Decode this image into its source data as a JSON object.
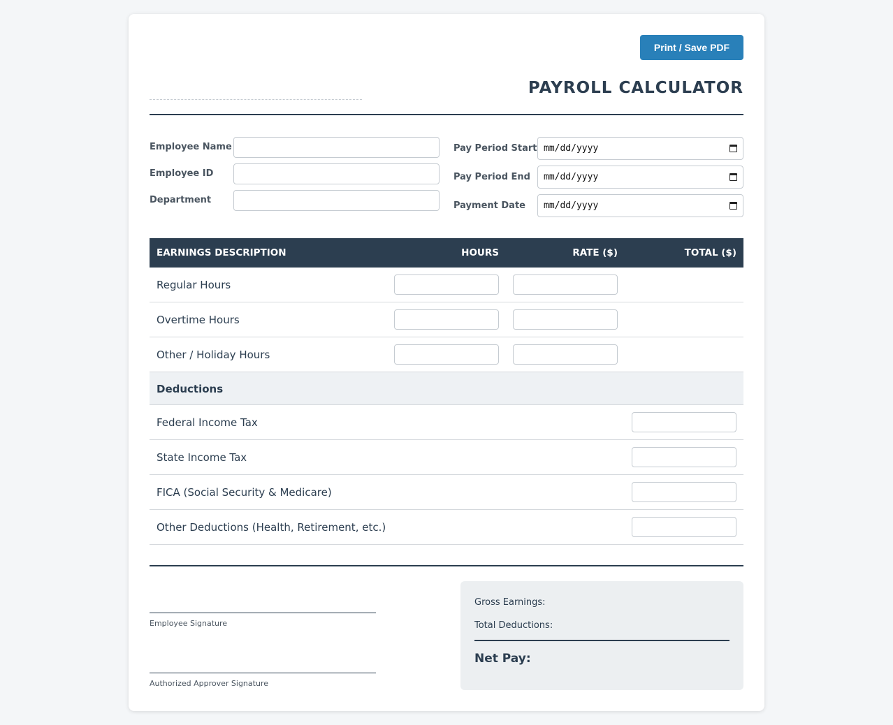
{
  "toolbar": {
    "print_label": "Print / Save PDF"
  },
  "header": {
    "title": "PAYROLL CALCULATOR"
  },
  "employee": {
    "name_label": "Employee Name",
    "id_label": "Employee ID",
    "department_label": "Department",
    "name_value": "",
    "id_value": "",
    "department_value": ""
  },
  "period": {
    "start_label": "Pay Period Start",
    "end_label": "Pay Period End",
    "payment_label": "Payment Date",
    "start_value": "mm/dd/yyyy",
    "end_value": "mm/dd/yyyy",
    "payment_value": "mm/dd/yyyy"
  },
  "earnings_table": {
    "columns": [
      "EARNINGS DESCRIPTION",
      "HOURS",
      "RATE ($)",
      "TOTAL ($)"
    ],
    "rows": [
      {
        "label": "Regular Hours",
        "hours": "",
        "rate": "",
        "total": ""
      },
      {
        "label": "Overtime Hours",
        "hours": "",
        "rate": "",
        "total": ""
      },
      {
        "label": "Other / Holiday Hours",
        "hours": "",
        "rate": "",
        "total": ""
      }
    ]
  },
  "deductions": {
    "heading": "Deductions",
    "rows": [
      {
        "label": "Federal Income Tax",
        "amount": ""
      },
      {
        "label": "State Income Tax",
        "amount": ""
      },
      {
        "label": "FICA (Social Security & Medicare)",
        "amount": ""
      },
      {
        "label": "Other Deductions (Health, Retirement, etc.)",
        "amount": ""
      }
    ]
  },
  "signatures": {
    "employee_label": "Employee Signature",
    "approver_label": "Authorized Approver Signature"
  },
  "summary": {
    "gross_label": "Gross Earnings:",
    "deductions_label": "Total Deductions:",
    "net_label": "Net Pay:",
    "gross_value": "",
    "deductions_value": "",
    "net_value": ""
  },
  "colors": {
    "primary_dark": "#2c3e50",
    "button_blue": "#2980b9",
    "page_bg": "#f4f6f8",
    "summary_bg": "#eceff1",
    "section_bg": "#eef1f4"
  }
}
